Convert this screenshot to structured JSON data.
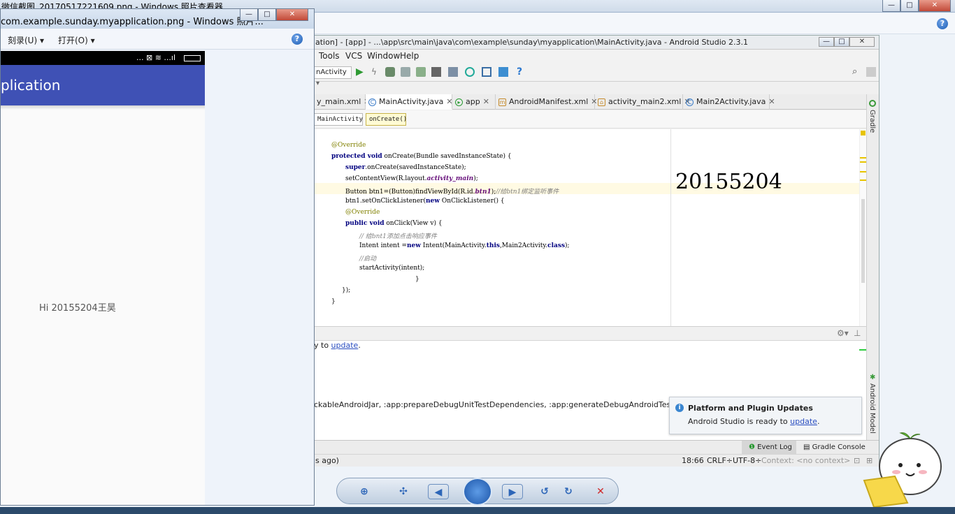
{
  "background_window": {
    "title": "微信截图_20170517221609.png - Windows 照片查看器",
    "controls": {
      "min": "—",
      "max": "□",
      "close": "✕"
    }
  },
  "photo_viewer": {
    "title": "com.example.sunday.myapplication.png - Windows 照片...",
    "menu": {
      "burn": "刻录(U)",
      "open": "打开(O)"
    },
    "help": "?",
    "phone": {
      "status_icons": "... ⊠ ≋ ...ıl",
      "app_title": "plication",
      "greeting": "Hi 20155204王昊"
    }
  },
  "android_studio": {
    "title": "ation] - [app] - ...\\app\\src\\main\\java\\com\\example\\sunday\\myapplication\\MainActivity.java - Android Studio 2.3.1",
    "menu": [
      "Tools",
      "VCS",
      "Window",
      "Help"
    ],
    "run_config": "nActivity",
    "tabs": [
      {
        "label": "y_main.xml",
        "active": false
      },
      {
        "label": "MainActivity.java",
        "active": true
      },
      {
        "label": "app",
        "active": false
      },
      {
        "label": "AndroidManifest.xml",
        "active": false
      },
      {
        "label": "activity_main2.xml",
        "active": false
      },
      {
        "label": "Main2Activity.java",
        "active": false
      }
    ],
    "breadcrumbs": [
      "MainActivity",
      "onCreate()"
    ],
    "code": [
      "@Override",
      "protected void onCreate(Bundle savedInstanceState) {",
      "super.onCreate(savedInstanceState);",
      "setContentView(R.layout.activity_main);",
      "Button btn1=(Button)findViewById(R.id.btn1);//给btn1绑定监听事件",
      "btn1.setOnClickListener(new OnClickListener() {",
      "@Override",
      "public void onClick(View v) {",
      "// 给bnt1添加点击响应事件",
      "Intent intent =new Intent(MainActivity.this,Main2Activity.class);",
      "//启动",
      "startActivity(intent);",
      "}",
      "});",
      "}"
    ],
    "overlay_number": "20155204",
    "console": {
      "line1_prefix": "y to ",
      "line1_link": "update",
      "line1_suffix": ".",
      "line2": "ckableAndroidJar, :app:prepareDebugUnitTestDependencies, :app:generateDebugAndroidTestSources]"
    },
    "notification": {
      "title": "Platform and Plugin Updates",
      "body_prefix": "Android Studio is ready to ",
      "body_link": "update",
      "body_suffix": "."
    },
    "side_labels": {
      "gradle": "Gradle",
      "android_model": "Android Model"
    },
    "bottom_tabs": {
      "event_log": "Event Log",
      "gradle_console": "Gradle Console"
    },
    "status": {
      "left": "s ago)",
      "position": "18:66",
      "line_sep": "CRLF÷",
      "encoding": "UTF-8÷",
      "context": "Context: <no context>"
    }
  },
  "viewer_controls": [
    "zoom-icon",
    "fit-icon",
    "prev-icon",
    "slideshow-icon",
    "next-icon",
    "rotate-left-icon",
    "rotate-right-icon",
    "delete-icon"
  ]
}
